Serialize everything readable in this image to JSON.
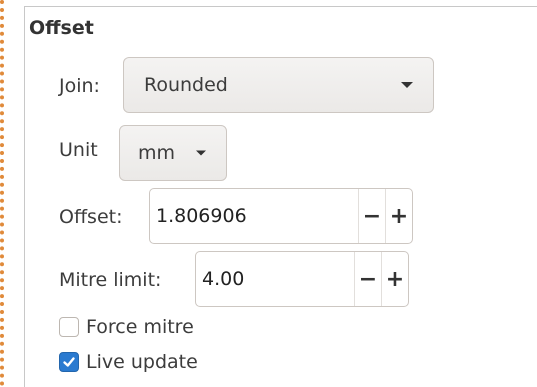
{
  "panel": {
    "title": "Offset"
  },
  "join": {
    "label": "Join:",
    "value": "Rounded"
  },
  "unit": {
    "label": "Unit",
    "value": "mm"
  },
  "offset": {
    "label": "Offset:",
    "value": "1.806906",
    "minus": "−",
    "plus": "+"
  },
  "mitre_limit": {
    "label": "Mitre limit:",
    "value": "4.00",
    "minus": "−",
    "plus": "+"
  },
  "force_mitre": {
    "label": "Force mitre",
    "checked": false
  },
  "live_update": {
    "label": "Live update",
    "checked": true
  },
  "colors": {
    "accent": "#2a7ad0",
    "dotted_border": "#e08a3a"
  }
}
